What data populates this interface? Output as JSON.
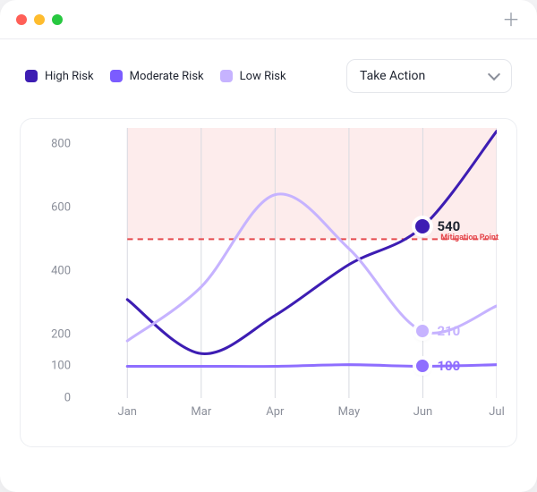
{
  "window": {
    "plus_title": "+"
  },
  "legend": {
    "items": [
      {
        "label": "High Risk",
        "color": "#3d1db3"
      },
      {
        "label": "Moderate Risk",
        "color": "#7b5cff"
      },
      {
        "label": "Low Risk",
        "color": "#c6b3ff"
      }
    ]
  },
  "dropdown": {
    "selected": "Take Action"
  },
  "mitigation": {
    "label": "Mitigation Point",
    "value": 500,
    "color": "#e5484d"
  },
  "markers": {
    "high": {
      "value": "540",
      "color": "#3d1db3"
    },
    "moderate": {
      "value": "100",
      "color": "#8e6eff"
    },
    "low": {
      "value": "210",
      "color": "#c6b3ff"
    }
  },
  "chart_data": {
    "type": "line",
    "xlabel": "",
    "ylabel": "",
    "ylim": [
      0,
      850
    ],
    "yticks": [
      0,
      100,
      200,
      400,
      600,
      800
    ],
    "categories": [
      "Jan",
      "Mar",
      "Apr",
      "May",
      "Jun",
      "Jul"
    ],
    "danger_zone_from": 500,
    "mitigation_point": 500,
    "series": [
      {
        "name": "High Risk",
        "color": "#3d1db3",
        "values": [
          310,
          140,
          260,
          420,
          540,
          840
        ],
        "marker_at": "Jun",
        "marker_value": 540
      },
      {
        "name": "Moderate Risk",
        "color": "#8e6eff",
        "values": [
          100,
          100,
          100,
          105,
          100,
          105
        ],
        "marker_at": "Jun",
        "marker_value": 100
      },
      {
        "name": "Low Risk",
        "color": "#c6b3ff",
        "values": [
          180,
          350,
          640,
          470,
          210,
          290
        ],
        "marker_at": "Jun",
        "marker_value": 210
      }
    ]
  }
}
